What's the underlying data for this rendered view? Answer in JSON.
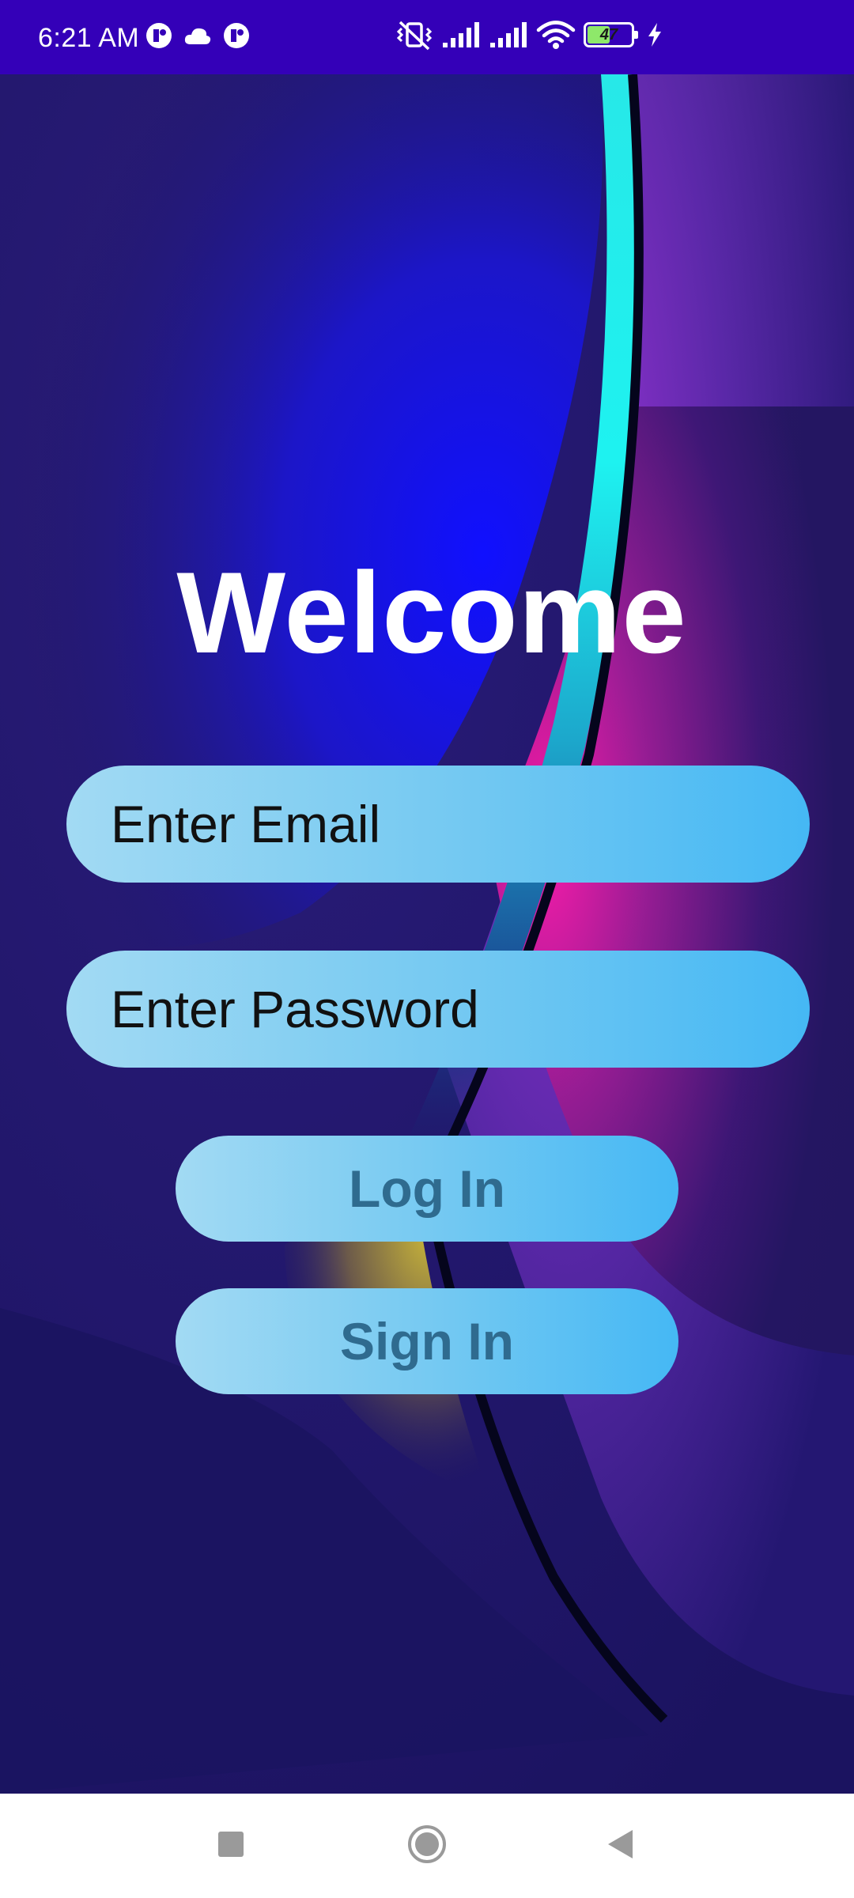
{
  "status_bar": {
    "time": "6:21 AM",
    "battery_level": "47",
    "left_icons": [
      "notification-app-icon",
      "cloud-icon",
      "notification-app-icon"
    ],
    "right_icons": [
      "vibrate-muted-icon",
      "signal-bars-icon",
      "signal-bars-icon",
      "wifi-icon",
      "battery-icon",
      "charging-bolt-icon"
    ]
  },
  "main": {
    "title": "Welcome",
    "email_field": {
      "value": "",
      "placeholder": "Enter Email"
    },
    "password_field": {
      "value": "",
      "placeholder": "Enter Password"
    },
    "login_label": "Log In",
    "signin_label": "Sign In"
  },
  "nav_bar": {
    "buttons": [
      "recent-apps-icon",
      "home-icon",
      "back-icon"
    ]
  },
  "colors": {
    "status_bar": "#3400b8",
    "background": "#1c1464",
    "pill_start": "#a2daf3",
    "pill_end": "#45b8f4",
    "button_text": "#2f6b8f"
  }
}
